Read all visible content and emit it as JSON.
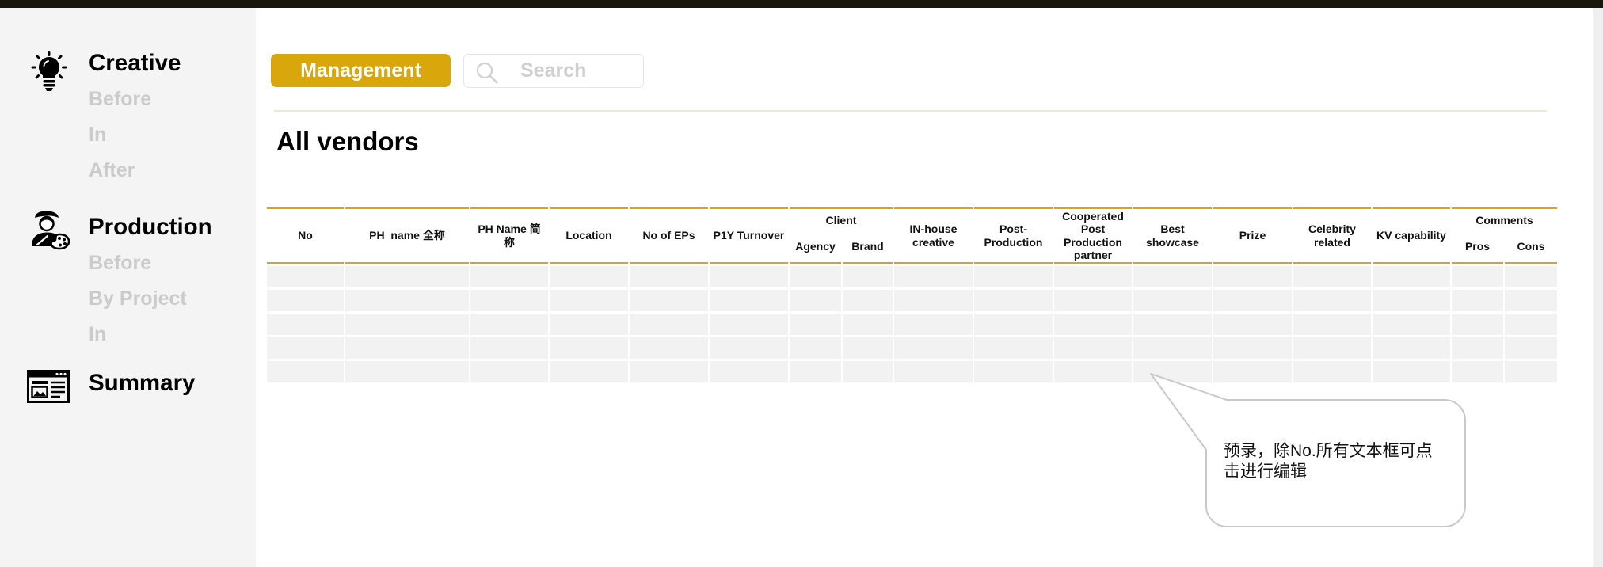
{
  "sidebar": {
    "sections": [
      {
        "title": "Creative",
        "icon": "lightbulb-icon",
        "items": [
          "Before",
          "In",
          "After"
        ]
      },
      {
        "title": "Production",
        "icon": "artist-palette-icon",
        "items": [
          "Before",
          "By Project",
          "In"
        ]
      },
      {
        "title": "Summary",
        "icon": "web-page-icon",
        "items": []
      }
    ]
  },
  "toolbar": {
    "management_label": "Management",
    "search_placeholder": "Search",
    "search_icon": "search-icon"
  },
  "page_title": "All vendors",
  "table": {
    "headers": {
      "no": "No",
      "ph_full_name": "PH  name 全称",
      "ph_short_name": "PH Name 简称",
      "location": "Location",
      "no_of_eps": "No of EPs",
      "p1y_turnover": "P1Y Turnover",
      "client": "Client",
      "agency": "Agency",
      "brand": "Brand",
      "inhouse_creative": "IN-house creative",
      "post_production": "Post-Production",
      "cooperated_partner": "Cooperated Post Production partner",
      "best_showcase": "Best showcase",
      "prize": "Prize",
      "celebrity_related": "Celebrity related",
      "kv_capability": "KV capability",
      "comments": "Comments",
      "pros": "Pros",
      "cons": "Cons"
    },
    "rows": [
      [
        "",
        "",
        "",
        "",
        "",
        "",
        "",
        "",
        "",
        "",
        "",
        "",
        "",
        "",
        "",
        "",
        ""
      ],
      [
        "",
        "",
        "",
        "",
        "",
        "",
        "",
        "",
        "",
        "",
        "",
        "",
        "",
        "",
        "",
        "",
        ""
      ],
      [
        "",
        "",
        "",
        "",
        "",
        "",
        "",
        "",
        "",
        "",
        "",
        "",
        "",
        "",
        "",
        "",
        ""
      ],
      [
        "",
        "",
        "",
        "",
        "",
        "",
        "",
        "",
        "",
        "",
        "",
        "",
        "",
        "",
        "",
        "",
        ""
      ],
      [
        "",
        "",
        "",
        "",
        "",
        "",
        "",
        "",
        "",
        "",
        "",
        "",
        "",
        "",
        "",
        "",
        ""
      ]
    ]
  },
  "callout": {
    "text": "预录，除No.所有文本框可点击进行编辑"
  },
  "colors": {
    "accent": "#d9a60b",
    "table_rule": "#d8a514",
    "top_bar": "#19170c",
    "sidebar_bg": "#f4f4f4",
    "row_bg": "#f2f2f2",
    "muted_text": "#cbcbcb"
  }
}
